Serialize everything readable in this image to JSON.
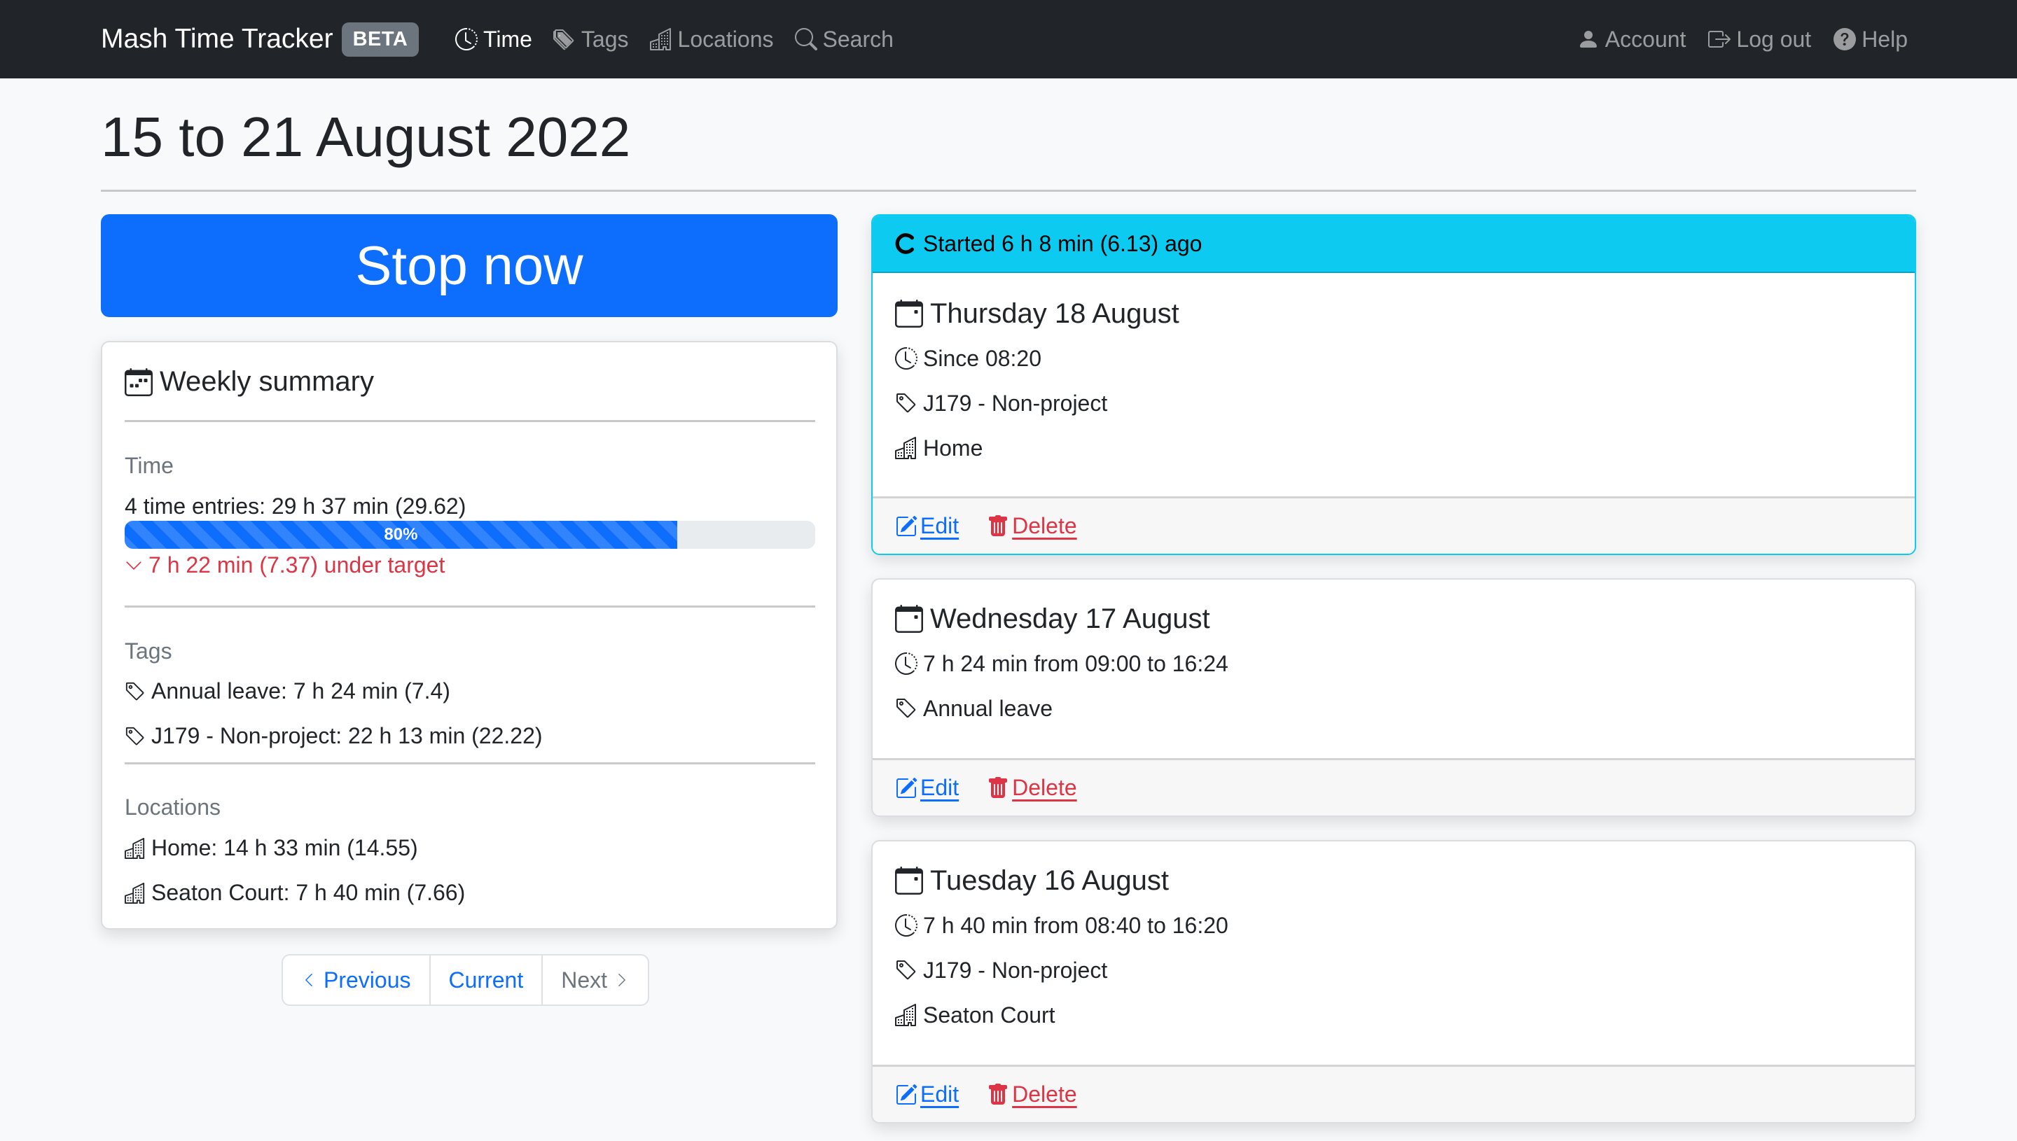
{
  "navbar": {
    "brand": "Mash Time Tracker",
    "badge": "BETA",
    "left_links": [
      {
        "label": "Time",
        "icon": "clock-icon",
        "active": true
      },
      {
        "label": "Tags",
        "icon": "tags-icon",
        "active": false
      },
      {
        "label": "Locations",
        "icon": "buildings-icon",
        "active": false
      },
      {
        "label": "Search",
        "icon": "search-icon",
        "active": false
      }
    ],
    "right_links": [
      {
        "label": "Account",
        "icon": "person-icon"
      },
      {
        "label": "Log out",
        "icon": "logout-icon"
      },
      {
        "label": "Help",
        "icon": "question-circle-icon"
      }
    ]
  },
  "page": {
    "title": "15 to 21 August 2022"
  },
  "stop_button": {
    "label": "Stop now"
  },
  "summary": {
    "title": "Weekly summary",
    "time": {
      "label": "Time",
      "entries_text": "4 time entries: 29 h 37 min (29.62)",
      "progress_percent": 80,
      "progress_label": "80%",
      "target_text": "7 h 22 min (7.37) under target"
    },
    "tags": {
      "label": "Tags",
      "items": [
        "Annual leave: 7 h 24 min (7.4)",
        "J179 - Non-project: 22 h 13 min (22.22)"
      ]
    },
    "locations": {
      "label": "Locations",
      "items": [
        "Home: 14 h 33 min (14.55)",
        "Seaton Court: 7 h 40 min (7.66)"
      ]
    }
  },
  "pagination": {
    "previous": "Previous",
    "current": "Current",
    "next": "Next"
  },
  "entries": [
    {
      "running_text": "Started 6 h 8 min (6.13) ago",
      "date": "Thursday 18 August",
      "time": "Since 08:20",
      "tag": "J179 - Non-project",
      "location": "Home",
      "edit": "Edit",
      "delete": "Delete"
    },
    {
      "date": "Wednesday 17 August",
      "time": "7 h 24 min from 09:00 to 16:24",
      "tag": "Annual leave",
      "edit": "Edit",
      "delete": "Delete"
    },
    {
      "date": "Tuesday 16 August",
      "time": "7 h 40 min from 08:40 to 16:20",
      "tag": "J179 - Non-project",
      "location": "Seaton Court",
      "edit": "Edit",
      "delete": "Delete"
    }
  ],
  "colors": {
    "navbar_bg": "#212529",
    "primary": "#0d6efd",
    "info": "#0dcaf0",
    "danger": "#dc3545",
    "muted": "#6c757d"
  }
}
